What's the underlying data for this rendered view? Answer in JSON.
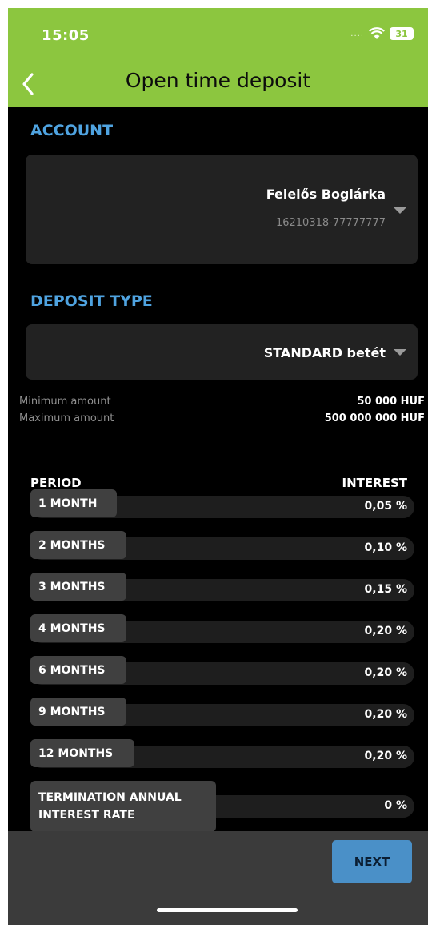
{
  "status": {
    "time": "15:05",
    "signal": "....",
    "battery": "31"
  },
  "header": {
    "title": "Open time deposit"
  },
  "account": {
    "label": "ACCOUNT",
    "name": "Felelős Boglárka",
    "number": "16210318-77777777"
  },
  "deposit_type": {
    "label": "DEPOSIT TYPE",
    "selected": "STANDARD betét"
  },
  "limits": {
    "min_label": "Minimum amount",
    "min_value": "50 000 HUF",
    "max_label": "Maximum amount",
    "max_value": "500 000 000 HUF"
  },
  "table": {
    "period_header": "PERIOD",
    "interest_header": "INTEREST",
    "rows": [
      {
        "period": "1 MONTH",
        "interest": "0,05 %"
      },
      {
        "period": "2 MONTHS",
        "interest": "0,10 %"
      },
      {
        "period": "3 MONTHS",
        "interest": "0,15 %"
      },
      {
        "period": "4 MONTHS",
        "interest": "0,20 %"
      },
      {
        "period": "6 MONTHS",
        "interest": "0,20 %"
      },
      {
        "period": "9 MONTHS",
        "interest": "0,20 %"
      },
      {
        "period": "12 MONTHS",
        "interest": "0,20 %"
      },
      {
        "period": "TERMINATION ANNUAL\nINTEREST RATE",
        "interest": "0 %"
      }
    ]
  },
  "footer": {
    "next_label": "NEXT"
  },
  "colors": {
    "header": "#8cc63f",
    "accent": "#4fa3e0",
    "button": "#4a90c8"
  }
}
